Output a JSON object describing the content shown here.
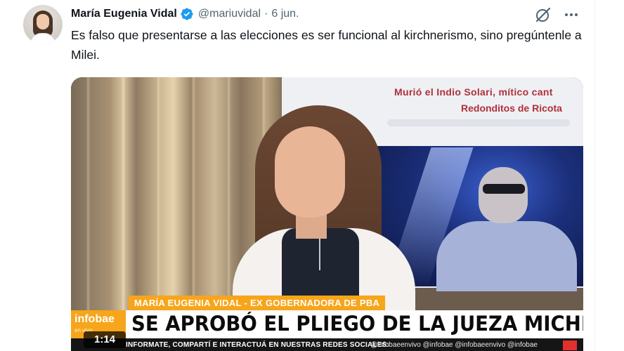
{
  "tweet": {
    "author_name": "María Eugenia Vidal",
    "handle": "@mariuvidal",
    "separator": "·",
    "date": "6 jun.",
    "text": "Es falso que presentarse a las elecciones es ser funcional al kirchnerismo, sino pregúntenle a Milei."
  },
  "icons": {
    "verified": "verified-badge-icon",
    "grok": "grok-icon",
    "more": "more-options-icon"
  },
  "colors": {
    "verified_blue": "#1d9bf0",
    "text_primary": "#0f1419",
    "text_secondary": "#536471",
    "infobae_orange": "#f7a51a"
  },
  "media": {
    "screen_line1": "Murió el Indio Solari, mítico cant",
    "screen_line2": "Redonditos de Ricota",
    "subtitle": "MARÍA EUGENIA VIDAL - EX GOBERNADORA DE PBA",
    "logo": "infobae",
    "logo_sub": "en vivo",
    "headline": "SE APROBÓ EL PLIEGO DE LA JUEZA MICHELLI",
    "ticker": "INFORMATE, COMPARTÍ E INTERACTUÁ EN NUESTRAS REDES SOCIALES:",
    "ticker_social": "@infobaeenvivo   @infobae   @infobaeenvivo   @infobae",
    "duration": "1:14"
  }
}
